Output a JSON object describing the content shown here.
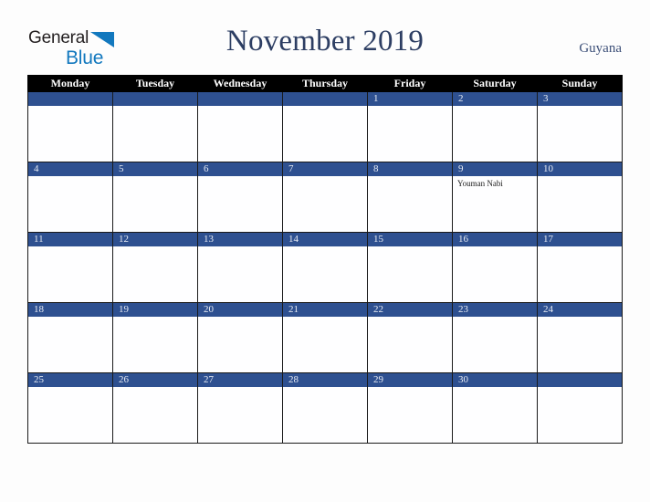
{
  "brand": {
    "name_part1": "General",
    "name_part2": "Blue",
    "triangle_icon": "triangle-icon",
    "colors": {
      "blue": "#1278be",
      "dark": "#231f20"
    }
  },
  "header": {
    "title": "November 2019",
    "country": "Guyana"
  },
  "calendar": {
    "colors": {
      "header_background": "#000000",
      "header_text": "#ffffff",
      "daybar_background": "#2e5090",
      "daybar_text": "#e8ecf4",
      "cell_background": "#fefeff",
      "border": "#1a1a1a"
    },
    "weekday_headers": [
      "Monday",
      "Tuesday",
      "Wednesday",
      "Thursday",
      "Friday",
      "Saturday",
      "Sunday"
    ],
    "weeks": [
      [
        {
          "date": "",
          "event": ""
        },
        {
          "date": "",
          "event": ""
        },
        {
          "date": "",
          "event": ""
        },
        {
          "date": "",
          "event": ""
        },
        {
          "date": "1",
          "event": ""
        },
        {
          "date": "2",
          "event": ""
        },
        {
          "date": "3",
          "event": ""
        }
      ],
      [
        {
          "date": "4",
          "event": ""
        },
        {
          "date": "5",
          "event": ""
        },
        {
          "date": "6",
          "event": ""
        },
        {
          "date": "7",
          "event": ""
        },
        {
          "date": "8",
          "event": ""
        },
        {
          "date": "9",
          "event": "Youman Nabi"
        },
        {
          "date": "10",
          "event": ""
        }
      ],
      [
        {
          "date": "11",
          "event": ""
        },
        {
          "date": "12",
          "event": ""
        },
        {
          "date": "13",
          "event": ""
        },
        {
          "date": "14",
          "event": ""
        },
        {
          "date": "15",
          "event": ""
        },
        {
          "date": "16",
          "event": ""
        },
        {
          "date": "17",
          "event": ""
        }
      ],
      [
        {
          "date": "18",
          "event": ""
        },
        {
          "date": "19",
          "event": ""
        },
        {
          "date": "20",
          "event": ""
        },
        {
          "date": "21",
          "event": ""
        },
        {
          "date": "22",
          "event": ""
        },
        {
          "date": "23",
          "event": ""
        },
        {
          "date": "24",
          "event": ""
        }
      ],
      [
        {
          "date": "25",
          "event": ""
        },
        {
          "date": "26",
          "event": ""
        },
        {
          "date": "27",
          "event": ""
        },
        {
          "date": "28",
          "event": ""
        },
        {
          "date": "29",
          "event": ""
        },
        {
          "date": "30",
          "event": ""
        },
        {
          "date": "",
          "event": ""
        }
      ]
    ]
  }
}
